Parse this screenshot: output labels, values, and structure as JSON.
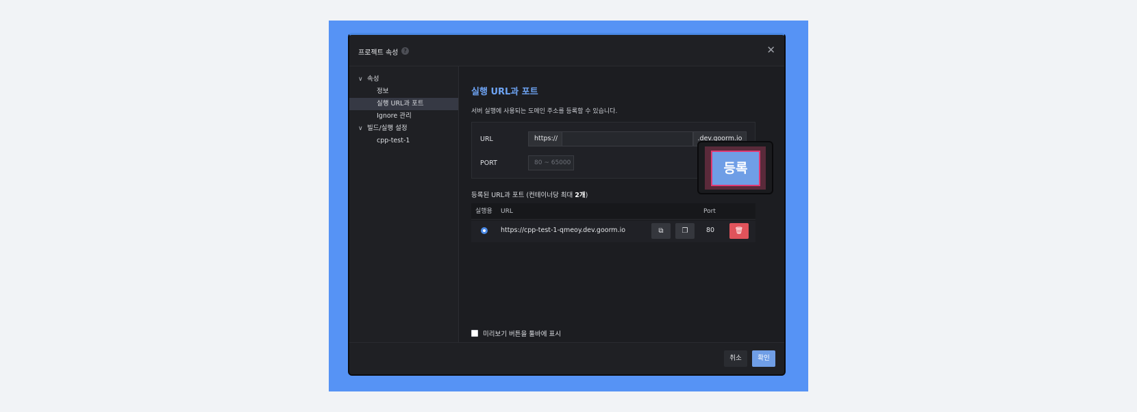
{
  "dialog": {
    "title": "프로젝트 속성",
    "help_icon": "?",
    "close_icon": "✕"
  },
  "sidebar": {
    "items": [
      {
        "label": "속성",
        "level": 0,
        "expanded": true
      },
      {
        "label": "정보",
        "level": 1
      },
      {
        "label": "실행 URL과 포트",
        "level": 1,
        "selected": true
      },
      {
        "label": "Ignore 관리",
        "level": 1
      },
      {
        "label": "빌드/실행 설정",
        "level": 0,
        "expanded": true
      },
      {
        "label": "cpp-test-1",
        "level": 1
      }
    ],
    "chevron": "∨"
  },
  "main": {
    "title": "실행 URL과 포트",
    "description": "서버 실행에 사용되는 도메인 주소를 등록할 수 있습니다.",
    "form": {
      "url_label": "URL",
      "url_prefix": "https://",
      "url_value": "",
      "url_suffix": ".dev.goorm.io",
      "port_label": "PORT",
      "port_placeholder": "80 ~ 65000",
      "register_button": "등록"
    },
    "registered_title_prefix": "등록된 URL과 포트 (컨테이너당 최대 ",
    "registered_title_bold": "2개",
    "registered_title_suffix": ")",
    "table": {
      "headers": {
        "run": "실행용",
        "url": "URL",
        "port": "Port"
      },
      "rows": [
        {
          "url": "https://cpp-test-1-qmeoy.dev.goorm.io",
          "port": "80",
          "selected": true
        }
      ],
      "open_icon": "⧉",
      "copy_icon": "❐",
      "delete_icon": "🗑"
    },
    "toolbar_checkbox_label": "미리보기 버튼을 툴바에 표시"
  },
  "footer": {
    "cancel": "취소",
    "ok": "확인"
  },
  "colors": {
    "accent": "#6ea4f4",
    "primary_button": "#6f9ee6",
    "danger": "#e0535b",
    "highlight": "#e03a74",
    "backdrop": "#5693f5"
  }
}
